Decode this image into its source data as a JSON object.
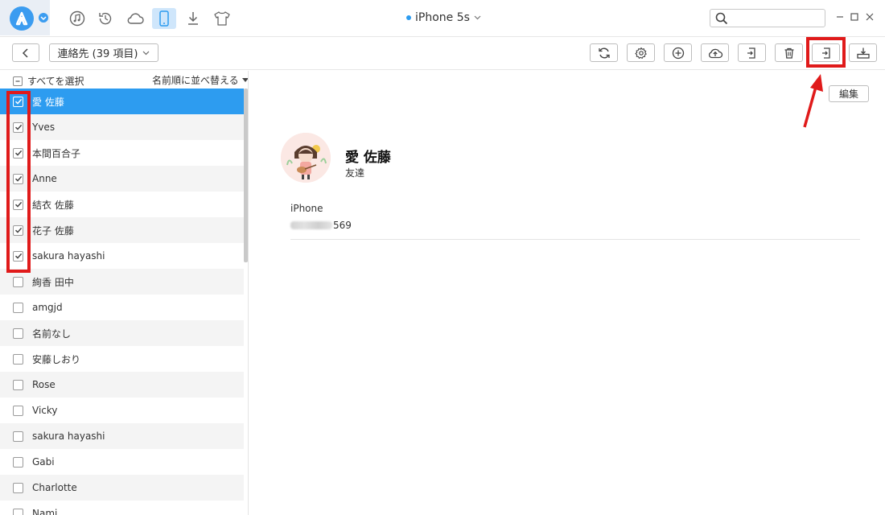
{
  "header": {
    "device": "iPhone 5s",
    "search": {
      "value": "",
      "placeholder": ""
    },
    "nav_icons": [
      "music-icon",
      "history-icon",
      "cloud-icon",
      "phone-icon",
      "download-icon",
      "tshirt-icon"
    ],
    "accent": "#2d9cf0"
  },
  "toolbar": {
    "category": "連絡先 (39 項目)",
    "buttons": [
      "refresh-icon",
      "settings-icon",
      "add-icon",
      "upload-cloud-icon",
      "export-icon",
      "delete-icon",
      "to-device-icon",
      "to-computer-icon"
    ]
  },
  "list": {
    "select_all": "すべてを選択",
    "sort_label": "名前順に並べ替える",
    "items": [
      {
        "name": "愛 佐藤",
        "checked": true,
        "selected": true
      },
      {
        "name": "Yves",
        "checked": true,
        "selected": false
      },
      {
        "name": "本間百合子",
        "checked": true,
        "selected": false
      },
      {
        "name": "Anne",
        "checked": true,
        "selected": false
      },
      {
        "name": "結衣 佐藤",
        "checked": true,
        "selected": false
      },
      {
        "name": "花子 佐藤",
        "checked": true,
        "selected": false
      },
      {
        "name": "sakura hayashi",
        "checked": true,
        "selected": false
      },
      {
        "name": "絢香 田中",
        "checked": false,
        "selected": false
      },
      {
        "name": "amgjd",
        "checked": false,
        "selected": false
      },
      {
        "name": "名前なし",
        "checked": false,
        "selected": false
      },
      {
        "name": "安藤しおり",
        "checked": false,
        "selected": false
      },
      {
        "name": "Rose",
        "checked": false,
        "selected": false
      },
      {
        "name": "Vicky",
        "checked": false,
        "selected": false
      },
      {
        "name": "sakura hayashi",
        "checked": false,
        "selected": false
      },
      {
        "name": "Gabi",
        "checked": false,
        "selected": false
      },
      {
        "name": "Charlotte",
        "checked": false,
        "selected": false
      },
      {
        "name": "Nami",
        "checked": false,
        "selected": false
      }
    ]
  },
  "detail": {
    "edit_label": "編集",
    "name": "愛 佐藤",
    "group": "友達",
    "phone_label": "iPhone",
    "phone_visible": "569"
  },
  "annotation": {
    "highlight_color": "#e01a1a"
  }
}
